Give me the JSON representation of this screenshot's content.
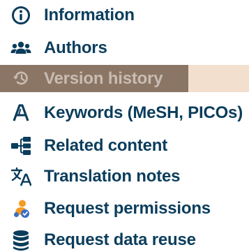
{
  "menu": {
    "items": [
      {
        "label": "Information",
        "icon": "info-circle-icon",
        "active": false
      },
      {
        "label": "Authors",
        "icon": "users-icon",
        "active": false
      },
      {
        "label": "Version history",
        "icon": "history-icon",
        "active": true
      },
      {
        "label": "Keywords (MeSH, PICOs)",
        "icon": "keywords-a-icon",
        "active": false
      },
      {
        "label": "Related content",
        "icon": "sitemap-icon",
        "active": false
      },
      {
        "label": "Translation notes",
        "icon": "translate-icon",
        "active": false
      },
      {
        "label": "Request permissions",
        "icon": "permissions-icon",
        "active": false
      },
      {
        "label": "Request data reuse",
        "icon": "database-icon",
        "active": false
      }
    ]
  },
  "colors": {
    "text": "#0b3d5c",
    "active_bg": "#8b7565",
    "active_bg_light": "#f2dfce",
    "active_text": "#c9bcb2",
    "permissions_orange": "#f59a23",
    "permissions_blue": "#3b6fc4"
  }
}
